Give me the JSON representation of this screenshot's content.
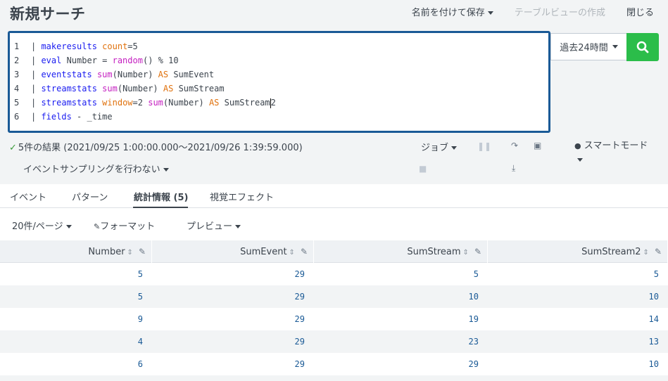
{
  "header": {
    "title": "新規サーチ",
    "save_as": "名前を付けて保存",
    "create_table_view": "テーブルビューの作成",
    "close": "閉じる"
  },
  "editor": {
    "line_numbers": [
      "1",
      "2",
      "3",
      "4",
      "5",
      "6"
    ],
    "lines": [
      [
        [
          "k-txt",
          "| "
        ],
        [
          "k-cmd",
          "makeresults"
        ],
        [
          "k-txt",
          " "
        ],
        [
          "k-kw",
          "count"
        ],
        [
          "k-txt",
          "=5"
        ]
      ],
      [
        [
          "k-txt",
          "| "
        ],
        [
          "k-cmd",
          "eval"
        ],
        [
          "k-txt",
          " Number = "
        ],
        [
          "k-fn",
          "random"
        ],
        [
          "k-txt",
          "() % 10"
        ]
      ],
      [
        [
          "k-txt",
          "| "
        ],
        [
          "k-cmd",
          "eventstats"
        ],
        [
          "k-txt",
          " "
        ],
        [
          "k-fn",
          "sum"
        ],
        [
          "k-txt",
          "(Number) "
        ],
        [
          "k-kw",
          "AS"
        ],
        [
          "k-txt",
          " SumEvent"
        ]
      ],
      [
        [
          "k-txt",
          "| "
        ],
        [
          "k-cmd",
          "streamstats"
        ],
        [
          "k-txt",
          " "
        ],
        [
          "k-fn",
          "sum"
        ],
        [
          "k-txt",
          "(Number) "
        ],
        [
          "k-kw",
          "AS"
        ],
        [
          "k-txt",
          " SumStream"
        ]
      ],
      [
        [
          "k-txt",
          "| "
        ],
        [
          "k-cmd",
          "streamstats"
        ],
        [
          "k-txt",
          " "
        ],
        [
          "k-kw",
          "window"
        ],
        [
          "k-txt",
          "=2 "
        ],
        [
          "k-fn",
          "sum"
        ],
        [
          "k-txt",
          "(Number) "
        ],
        [
          "k-kw",
          "AS"
        ],
        [
          "k-txt",
          " SumStream"
        ],
        [
          "cursor",
          ""
        ],
        [
          "k-txt",
          "2"
        ]
      ],
      [
        [
          "k-txt",
          "| "
        ],
        [
          "k-cmd",
          "fields"
        ],
        [
          "k-txt",
          " - _time"
        ]
      ]
    ]
  },
  "time_picker": {
    "label": "過去24時間"
  },
  "status": {
    "result_text": "5件の結果 (2021/09/25 1:00:00.000〜2021/09/26 1:39:59.000)",
    "sampling": "イベントサンプリングを行わない",
    "job": "ジョブ",
    "smart_mode": "スマートモード"
  },
  "tabs": [
    {
      "label": "イベント"
    },
    {
      "label": "パターン"
    },
    {
      "label": "統計情報 (5)"
    },
    {
      "label": "視覚エフェクト"
    }
  ],
  "toolbar": {
    "per_page": "20件/ページ",
    "format": "フォーマット",
    "preview": "プレビュー"
  },
  "table": {
    "columns": [
      "Number",
      "SumEvent",
      "SumStream",
      "SumStream2"
    ],
    "rows": [
      [
        "5",
        "29",
        "5",
        "5"
      ],
      [
        "5",
        "29",
        "10",
        "10"
      ],
      [
        "9",
        "29",
        "19",
        "14"
      ],
      [
        "4",
        "29",
        "23",
        "13"
      ],
      [
        "6",
        "29",
        "29",
        "10"
      ]
    ]
  },
  "colors": {
    "search_button": "#2bbd4a",
    "editor_border": "#1a5a96",
    "command": "#1a1cf0",
    "function": "#c41ec0",
    "keyword": "#e0720e"
  }
}
